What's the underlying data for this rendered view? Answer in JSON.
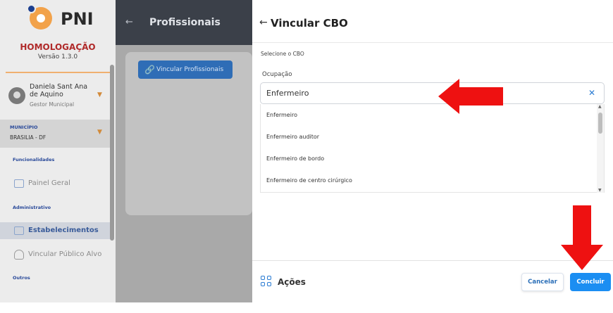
{
  "app": {
    "brand": "PNI",
    "environment": "HOMOLOGAÇÃO",
    "version": "Versão 1.3.0"
  },
  "user": {
    "name": "Daniela Sant Ana de Aquino",
    "role": "Gestor Municipal"
  },
  "municipality": {
    "label": "MUNICÍPIO",
    "value": "BRASILIA - DF"
  },
  "sidebar": {
    "sections": [
      {
        "title": "Funcionalidades",
        "items": [
          {
            "label": "Painel Geral",
            "icon": "dashboard-icon"
          }
        ]
      },
      {
        "title": "Administrativo",
        "items": [
          {
            "label": "Estabelecimentos",
            "icon": "building-icon",
            "active": true
          },
          {
            "label": "Vincular Público Alvo",
            "icon": "person-icon"
          }
        ]
      },
      {
        "title": "Outros",
        "items": []
      }
    ]
  },
  "page": {
    "title": "Profissionais",
    "primary_button": "Vincular Profissionais"
  },
  "drawer": {
    "title": "Vincular CBO",
    "select_label": "Selecione o CBO",
    "occupation_label": "Ocupação",
    "occupation_value": "Enfermeiro",
    "options": [
      "Enfermeiro",
      "Enfermeiro auditor",
      "Enfermeiro de bordo",
      "Enfermeiro de centro cirúrgico"
    ],
    "actions_label": "Ações",
    "cancel_label": "Cancelar",
    "confirm_label": "Concluir"
  },
  "colors": {
    "accent": "#1b8ef2",
    "annotation": "#ee1111",
    "env": "#b02a2a"
  }
}
